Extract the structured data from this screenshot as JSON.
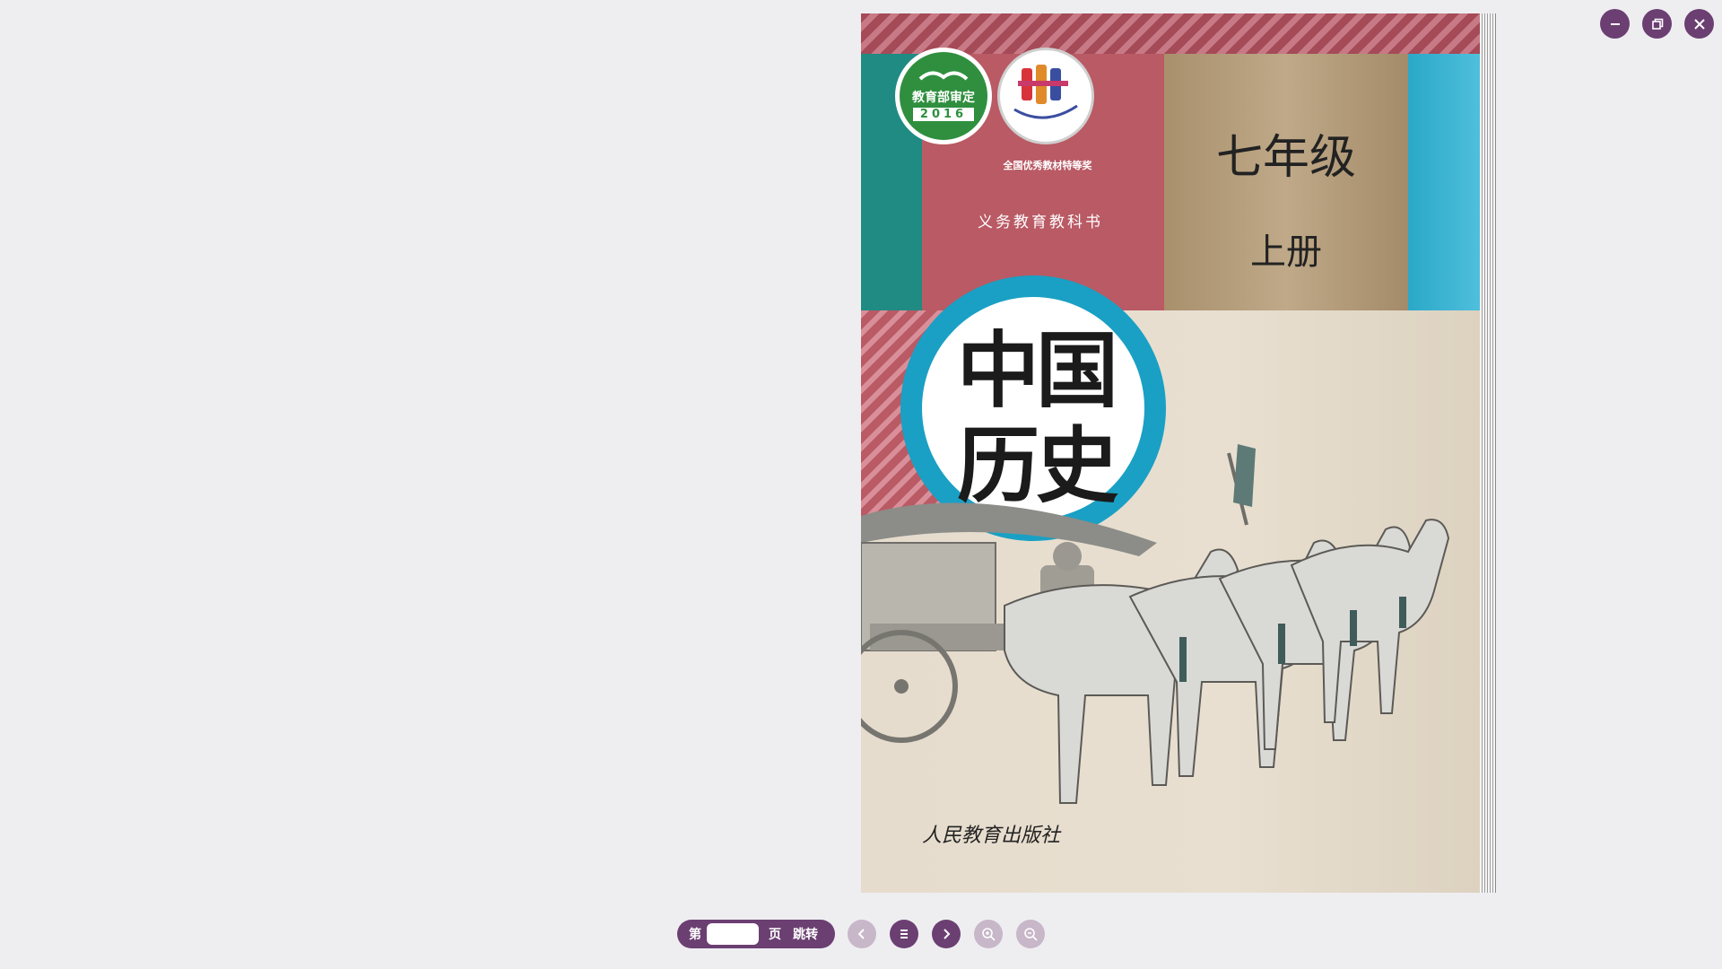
{
  "window_controls": {
    "minimize_icon": "minimize-icon",
    "restore_icon": "restore-icon",
    "close_icon": "close-icon"
  },
  "cover": {
    "badge_approval_text": "教育部审定",
    "badge_approval_year": "2016",
    "award_text": "全国优秀教材特等奖",
    "series": "义务教育教科书",
    "grade": "七年级",
    "volume": "上册",
    "title_line1": "中国",
    "title_line2": "历史",
    "publisher": "人民教育出版社"
  },
  "toolbar": {
    "page_prefix": "第",
    "page_input_value": "",
    "page_suffix": "页",
    "jump_label": "跳转",
    "buttons": [
      "prev-page",
      "table-of-contents",
      "next-page",
      "zoom-in",
      "zoom-out"
    ]
  },
  "colors": {
    "accent": "#6b3f72",
    "accent_disabled": "#c8b6c9",
    "background": "#eeeef1"
  }
}
